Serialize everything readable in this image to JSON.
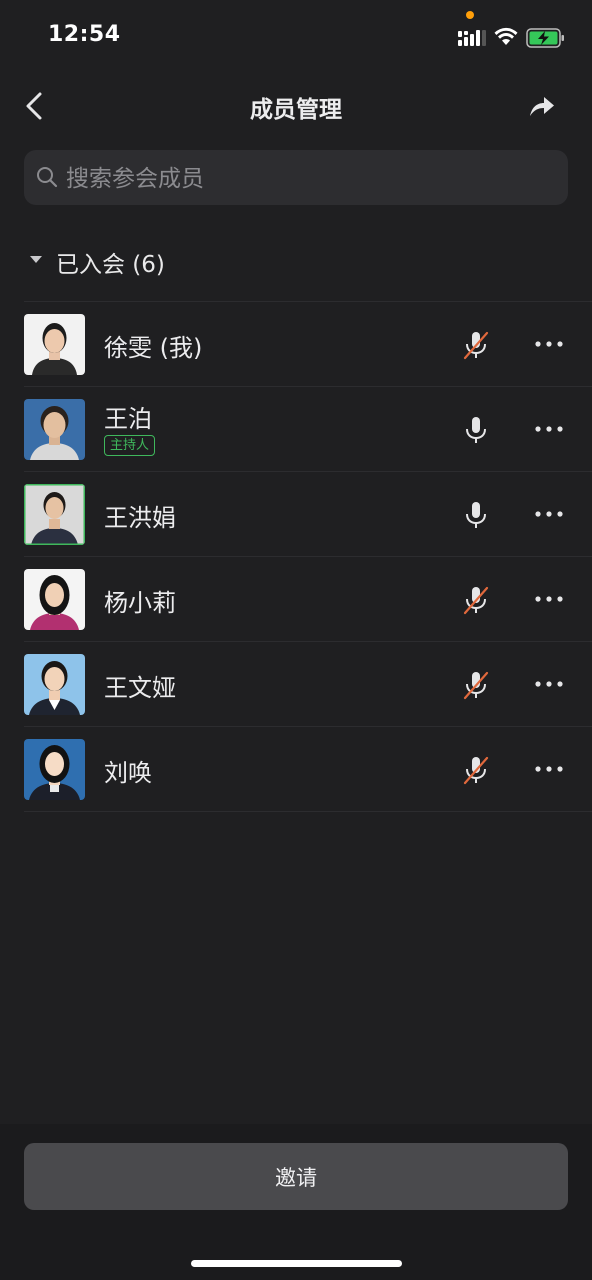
{
  "status_bar": {
    "time": "12:54"
  },
  "nav": {
    "title": "成员管理",
    "back_icon": "chevron-left-icon",
    "share_icon": "share-arrow-icon"
  },
  "search": {
    "placeholder": "搜索参会成员",
    "value": ""
  },
  "section": {
    "label": "已入会 (6)",
    "count": 6
  },
  "members": [
    {
      "name": "徐雯 (我)",
      "badge": "",
      "mic": "muted",
      "avatar_bg": "#f2f2f2",
      "speaking": false
    },
    {
      "name": "王泊",
      "badge": "主持人",
      "mic": "on",
      "avatar_bg": "#3a6ea8",
      "speaking": false
    },
    {
      "name": "王洪娟",
      "badge": "",
      "mic": "on",
      "avatar_bg": "#d9d9d9",
      "speaking": true
    },
    {
      "name": "杨小莉",
      "badge": "",
      "mic": "muted",
      "avatar_bg": "#f4f4f4",
      "speaking": false
    },
    {
      "name": "王文娅",
      "badge": "",
      "mic": "muted",
      "avatar_bg": "#8ec3ea",
      "speaking": false
    },
    {
      "name": "刘唤",
      "badge": "",
      "mic": "muted",
      "avatar_bg": "#2f6fb0",
      "speaking": false
    }
  ],
  "invite": {
    "label": "邀请"
  },
  "colors": {
    "accent_green": "#3fb85c",
    "mute_slash": "#e0683c",
    "background": "#1f1f21"
  }
}
